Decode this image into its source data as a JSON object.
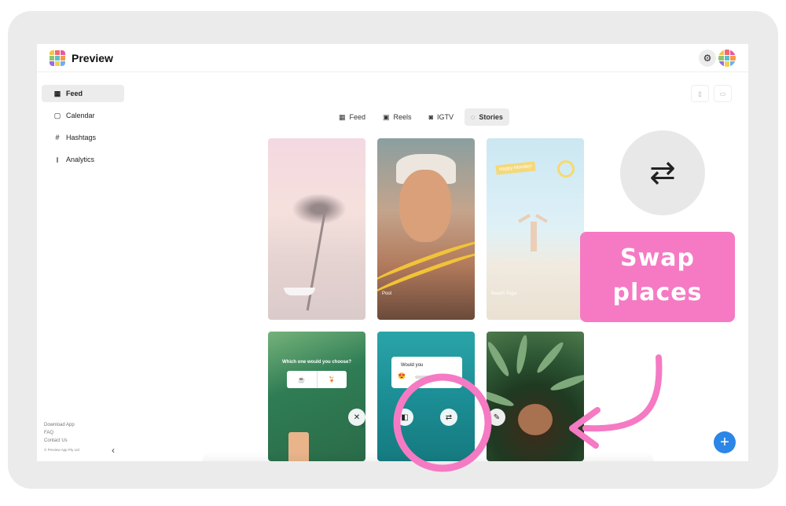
{
  "app": {
    "brand": "Preview",
    "logo_colors": [
      "#f4c34a",
      "#ef6b6b",
      "#e45aa3",
      "#8ac76f",
      "#5cc0c8",
      "#f59a4a",
      "#9d6be0",
      "#f0d04f",
      "#6ab2f0"
    ],
    "avatar_colors": [
      "#f4c34a",
      "#ef6b6b",
      "#e45aa3",
      "#8ac76f",
      "#5cc0c8",
      "#f59a4a",
      "#9d6be0",
      "#f0d04f",
      "#6ab2f0"
    ],
    "settings_icon": "gear-icon"
  },
  "sidebar": {
    "items": [
      {
        "label": "Feed",
        "icon": "grid-icon",
        "glyph": "▦",
        "active": true
      },
      {
        "label": "Calendar",
        "icon": "calendar-icon",
        "glyph": "▢",
        "active": false
      },
      {
        "label": "Hashtags",
        "icon": "hashtag-icon",
        "glyph": "#",
        "active": false
      },
      {
        "label": "Analytics",
        "icon": "analytics-icon",
        "glyph": "⫾",
        "active": false
      }
    ],
    "footer_links": [
      "Download App",
      "FAQ",
      "Contact Us"
    ],
    "copyright": "© Preview App Pty Ltd",
    "collapse_glyph": "‹"
  },
  "view_toggle": {
    "phone_glyph": "▯",
    "tablet_glyph": "▭"
  },
  "tabs": [
    {
      "label": "Feed",
      "icon": "grid-icon",
      "glyph": "▦",
      "active": false
    },
    {
      "label": "Reels",
      "icon": "reels-icon",
      "glyph": "▣",
      "active": false
    },
    {
      "label": "IGTV",
      "icon": "igtv-icon",
      "glyph": "◙",
      "active": false
    },
    {
      "label": "Stories",
      "icon": "stories-icon",
      "glyph": "◌",
      "active": true
    }
  ],
  "stories": {
    "card2_caption": "Pool",
    "card3_caption": "Beach Yoga",
    "card3_tag": "Happy Monday!",
    "card4_question": "Which one would you choose?",
    "card4_options": [
      "☕",
      "🍹"
    ],
    "card4_remove_glyph": "✕",
    "card4_count": "2",
    "card5_prompt": "Would you",
    "card5_emoji": "😍",
    "card5_swap_glyph": "⇄",
    "card5_left_glyph": "◧",
    "card6_edit_glyph": "✎"
  },
  "annotation": {
    "swap_glyph": "⇄",
    "label_line1": "Swap",
    "label_line2": "places",
    "highlight_color": "#f57ac3"
  },
  "fab": {
    "glyph": "+",
    "color": "#2b86e6"
  }
}
